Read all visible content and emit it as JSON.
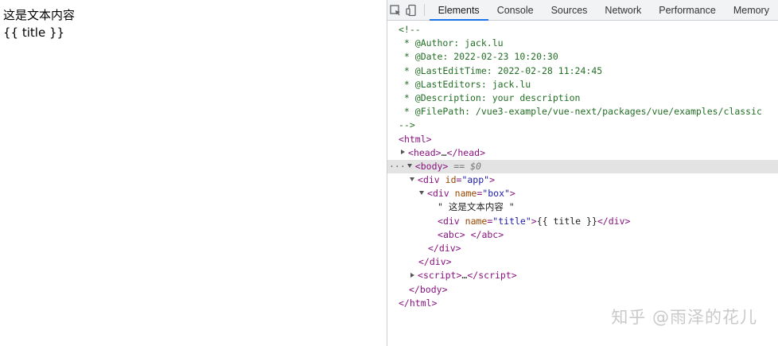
{
  "page": {
    "line1": "这是文本内容",
    "line2": "{{ title }}"
  },
  "devtools": {
    "tabs": [
      "Elements",
      "Console",
      "Sources",
      "Network",
      "Performance",
      "Memory"
    ],
    "active_tab": "Elements",
    "comment": {
      "open": "<!--",
      "lines": [
        " * @Author: jack.lu",
        " * @Date: 2022-02-23 10:20:30",
        " * @LastEditTime: 2022-02-28 11:24:45",
        " * @LastEditors: jack.lu",
        " * @Description: your description",
        " * @FilePath: /vue3-example/vue-next/packages/vue/examples/classic"
      ],
      "close": "-->"
    },
    "dom": {
      "html_open": "html",
      "head": "head",
      "head_ellipsis": "…",
      "body": "body",
      "selected_marker": " == ",
      "selected_var": "$0",
      "div_app_tag": "div",
      "div_app_attr": "id",
      "div_app_val": "\"app\"",
      "div_box_tag": "div",
      "div_box_attr": "name",
      "div_box_val": "\"box\"",
      "text_node": "\" 这是文本内容 \"",
      "div_title_tag": "div",
      "div_title_attr": "name",
      "div_title_val": "\"title\"",
      "div_title_text": "{{ title }}",
      "abc_tag": "abc",
      "abc_text": " ",
      "script": "script",
      "script_ellipsis": "…"
    }
  },
  "watermark": "知乎 @雨泽的花儿"
}
